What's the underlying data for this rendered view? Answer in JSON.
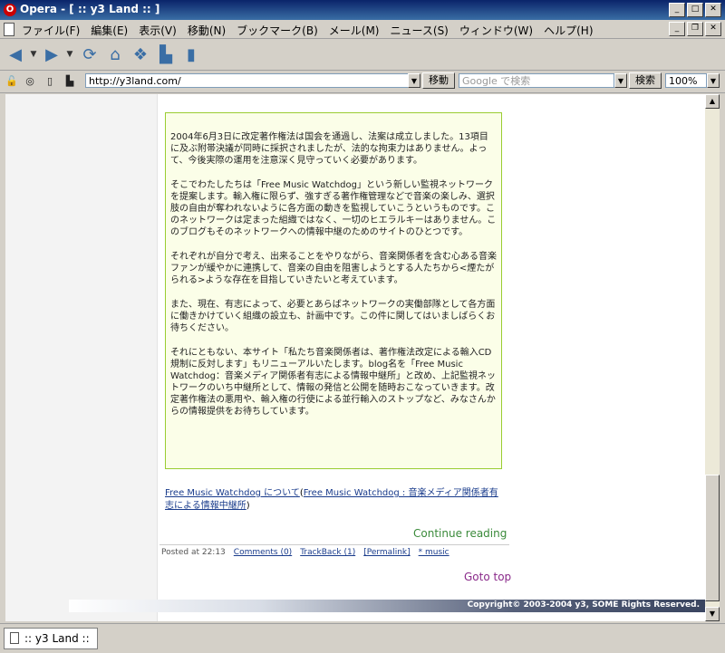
{
  "window": {
    "title": "Opera - [ :: y3 Land :: ]"
  },
  "menu": [
    "ファイル(F)",
    "編集(E)",
    "表示(V)",
    "移動(N)",
    "ブックマーク(B)",
    "メール(M)",
    "ニュース(S)",
    "ウィンドウ(W)",
    "ヘルプ(H)"
  ],
  "address": {
    "url": "http://y3land.com/",
    "go_label": "移動"
  },
  "search": {
    "placeholder": "Google で検索",
    "button_label": "検索"
  },
  "zoom": "100%",
  "post": {
    "paragraphs": [
      "2004年6月3日に改定著作権法は国会を通過し、法案は成立しました。13項目に及ぶ附帯決議が同時に採択されましたが、法的な拘束力はありません。よって、今後実際の運用を注意深く見守っていく必要があります。",
      "そこでわたしたちは「Free Music Watchdog」という新しい監視ネットワークを提案します。輸入権に限らず、強すぎる著作権管理などで音楽の楽しみ、選択肢の自由が奪われないように各方面の動きを監視していこうというものです。このネットワークは定まった組織ではなく、一切のヒエラルキーはありません。このブログもそのネットワークへの情報中継のためのサイトのひとつです。",
      "それぞれが自分で考え、出来ることをやりながら、音楽関係者を含む心ある音楽ファンが緩やかに連携して、音楽の自由を阻害しようとする人たちから<煙たがられる>ような存在を目指していきたいと考えています。",
      "また、現在、有志によって、必要とあらばネットワークの実働部隊として各方面に働きかけていく組織の設立も、計画中です。この件に関してはいましばらくお待ちください。",
      "それにともない、本サイト「私たち音楽関係者は、著作権法改定による輸入CD規制に反対します」もリニューアルいたします。blog名を「Free Music Watchdog：音楽メディア関係者有志による情報中継所」と改め、上記監視ネットワークのいち中継所として、情報の発信と公開を随時おこなっていきます。改定著作権法の悪用や、輸入権の行使による並行輸入のストップなど、みなさんからの情報提供をお待ちしています。"
    ],
    "link_main": "Free Music Watchdog について",
    "link_paren_open": "(",
    "link_sub": "Free Music Watchdog : 音楽メディア関係者有志による情報中継所",
    "link_paren_close": ")",
    "continue": "Continue reading",
    "posted_at": "Posted at 22:13",
    "comments": "Comments (0)",
    "trackback": "TrackBack (1)",
    "permalink": "[Permalink]",
    "category": "* music",
    "gototop": "Goto top"
  },
  "footer": {
    "copyright": "Copyright© 2003-2004 y3, SOME Rights Reserved."
  },
  "tab": {
    "label": ":: y3 Land ::"
  }
}
